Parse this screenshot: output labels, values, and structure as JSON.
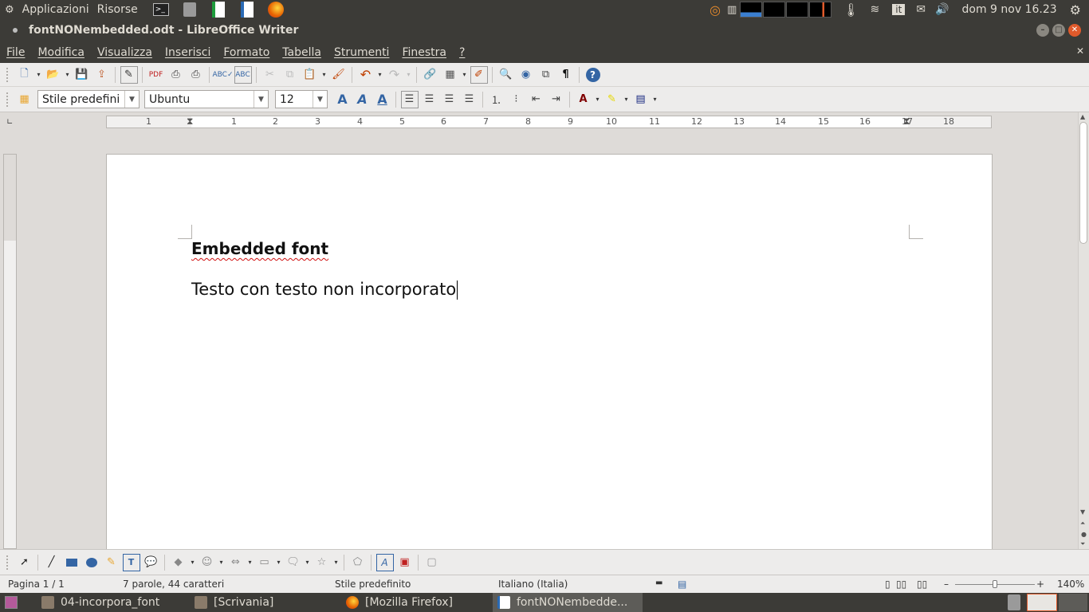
{
  "top_panel": {
    "menus": [
      "Applicazioni",
      "Risorse"
    ],
    "clock": "dom  9 nov 16.23",
    "keyboard_layout": "it"
  },
  "window": {
    "title": "fontNONembedded.odt - LibreOffice Writer"
  },
  "menubar": [
    "File",
    "Modifica",
    "Visualizza",
    "Inserisci",
    "Formato",
    "Tabella",
    "Strumenti",
    "Finestra",
    "?"
  ],
  "formatting": {
    "paragraph_style": "Stile predefini",
    "font_name": "Ubuntu",
    "font_size": "12"
  },
  "ruler": {
    "labels": [
      "1",
      "1",
      "2",
      "3",
      "4",
      "5",
      "6",
      "7",
      "8",
      "9",
      "10",
      "11",
      "12",
      "13",
      "14",
      "15",
      "16",
      "17",
      "18"
    ]
  },
  "document": {
    "heading": "Embedded font",
    "body": "Testo con testo non incorporato"
  },
  "statusbar": {
    "page": "Pagina 1 / 1",
    "words": "7 parole, 44 caratteri",
    "page_style": "Stile predefinito",
    "language": "Italiano (Italia)",
    "zoom": "140%"
  },
  "taskbar": {
    "tasks": [
      "04-incorpora_font",
      "[Scrivania]",
      "[Mozilla Firefox]",
      "fontNONembedde..."
    ]
  }
}
